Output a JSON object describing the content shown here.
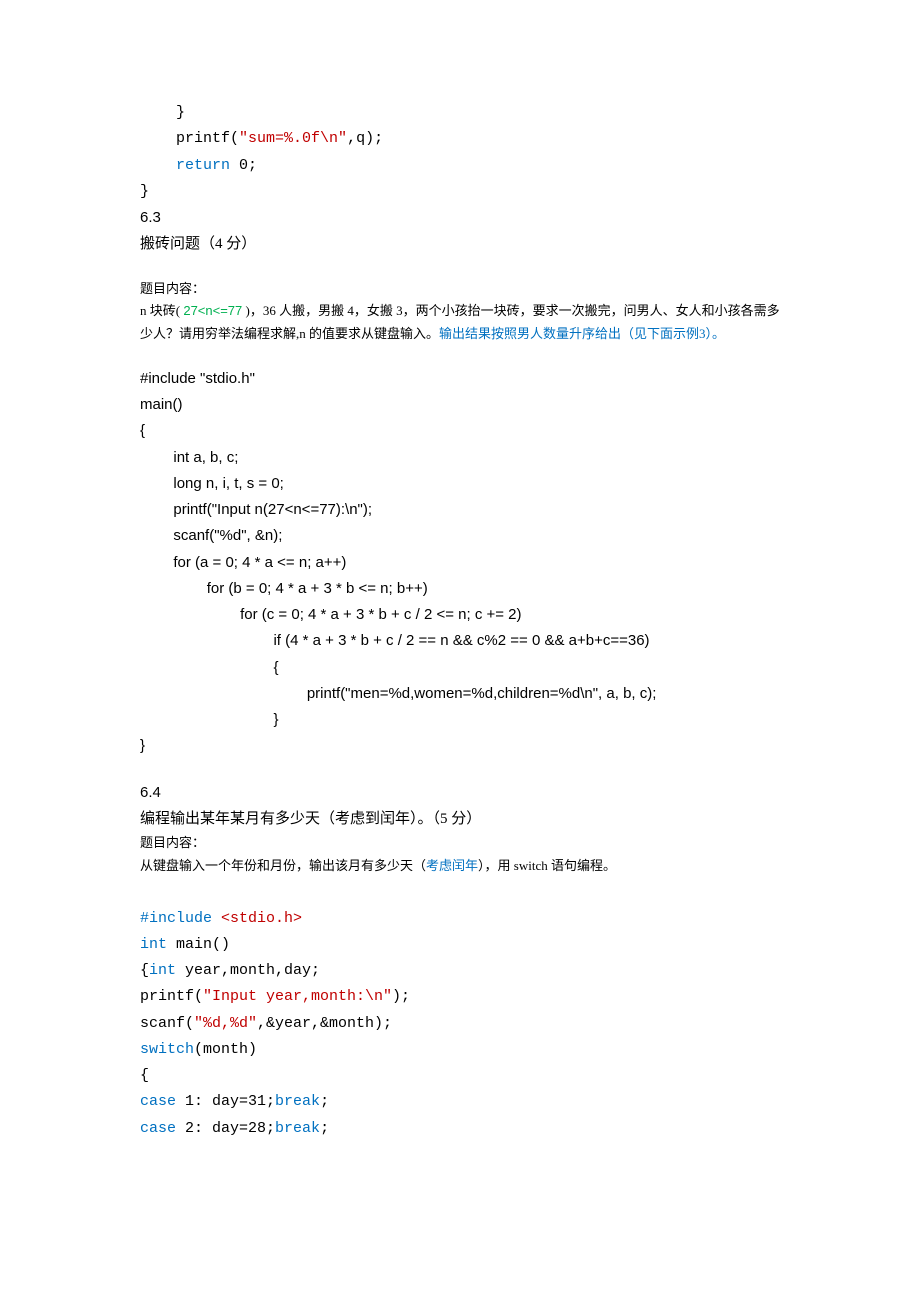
{
  "snippet1": {
    "l1": "    }",
    "l2a": "    printf(",
    "l2b": "\"sum=%.0f\\n\"",
    "l2c": ",q);",
    "l3a": "    ",
    "l3b": "return",
    "l3c": " 0;",
    "l4": "}"
  },
  "s63": {
    "num": "6.3",
    "title": "搬砖问题（4 分）",
    "label": "题目内容：",
    "desc_a": "n 块砖( ",
    "desc_b": "27<n<=77",
    "desc_c": " )，36 人搬，男搬 4，女搬 3，两个小孩抬一块砖，要求一次搬完，问男人、女人和小孩各需多少人？请用穷举法编程求解,n 的值要求从键盘输入。",
    "desc_d": "输出结果按照男人数量升序给出（见下面示例3）。"
  },
  "code63": {
    "l1": "#include \"stdio.h\"",
    "l2": "main()",
    "l3": "{",
    "l4": "int a, b, c;",
    "l5": "long n, i, t, s = 0;",
    "l6": "printf(\"Input n(27<n<=77):\\n\");",
    "l7": "scanf(\"%d\", &n);",
    "l8": "for (a = 0; 4 * a <= n; a++)",
    "l9": "for (b = 0; 4 * a + 3 * b <= n; b++)",
    "l10": "for (c = 0; 4 * a + 3 * b + c / 2 <= n; c += 2)",
    "l11": "if (4 * a + 3 * b + c / 2 == n && c%2 == 0 && a+b+c==36)",
    "l12": "{",
    "l13": "printf(\"men=%d,women=%d,children=%d\\n\", a, b, c);",
    "l14": "}",
    "l15": "}"
  },
  "s64": {
    "num": "6.4",
    "title": "编程输出某年某月有多少天（考虑到闰年）。（5 分）",
    "label": "题目内容：",
    "desc_a": "从键盘输入一个年份和月份，输出该月有多少天（",
    "desc_b": "考虑闰年",
    "desc_c": "），用 switch 语句编程。"
  },
  "code64": {
    "l1a": "#include",
    "l1b": " <stdio.h>",
    "l2a": "int",
    "l2b": " main()",
    "l3a": "{",
    "l3b": "int",
    "l3c": " year,month,day;",
    "l4a": "printf(",
    "l4b": "\"Input year,month:\\n\"",
    "l4c": ");",
    "l5a": "scanf(",
    "l5b": "\"%d,%d\"",
    "l5c": ",&year,&month);",
    "l6a": "switch",
    "l6b": "(month)",
    "l7": "{",
    "l8a": "case",
    "l8b": " 1: day=31;",
    "l8c": "break",
    "l8d": ";",
    "l9a": "case",
    "l9b": " 2: day=28;",
    "l9c": "break",
    "l9d": ";"
  }
}
